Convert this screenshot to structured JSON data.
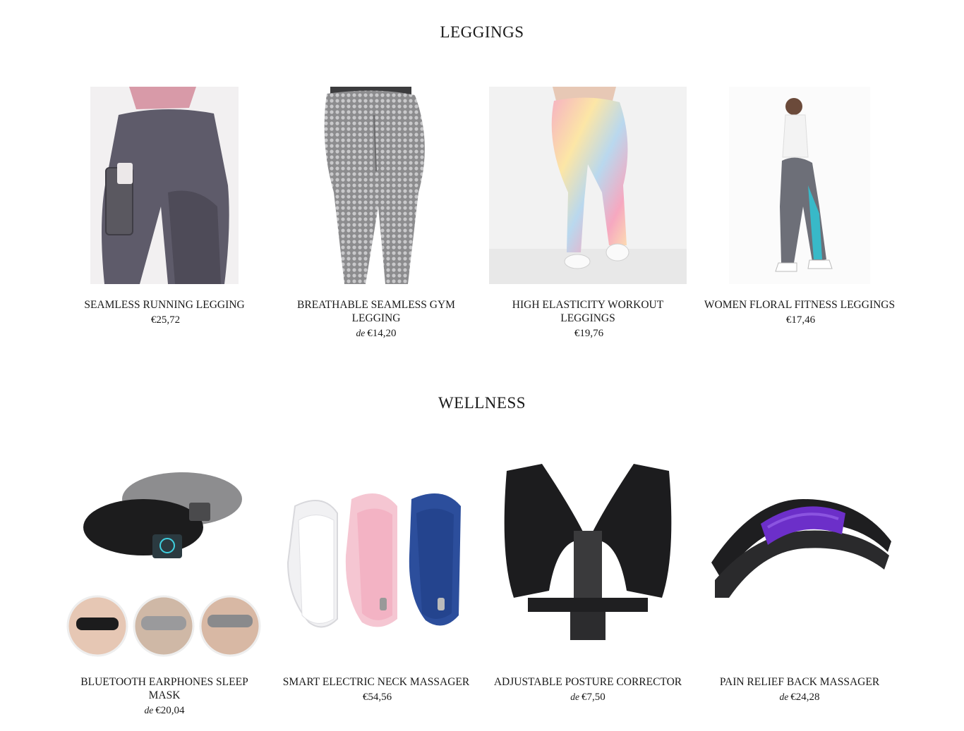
{
  "sections": [
    {
      "title": "LEGGINGS",
      "products": [
        {
          "name": "SEAMLESS RUNNING LEGGING",
          "price": "€25,72",
          "from": ""
        },
        {
          "name": "BREATHABLE SEAMLESS GYM LEGGING",
          "price": "€14,20",
          "from": "de"
        },
        {
          "name": "HIGH ELASTICITY WORKOUT LEGGINGS",
          "price": "€19,76",
          "from": ""
        },
        {
          "name": "WOMEN FLORAL FITNESS LEGGINGS",
          "price": "€17,46",
          "from": ""
        }
      ]
    },
    {
      "title": "WELLNESS",
      "products": [
        {
          "name": "BLUETOOTH EARPHONES SLEEP MASK",
          "price": "€20,04",
          "from": "de"
        },
        {
          "name": "SMART ELECTRIC NECK MASSAGER",
          "price": "€54,56",
          "from": ""
        },
        {
          "name": "ADJUSTABLE POSTURE CORRECTOR",
          "price": "€7,50",
          "from": "de"
        },
        {
          "name": "PAIN RELIEF BACK MASSAGER",
          "price": "€24,28",
          "from": "de"
        }
      ]
    }
  ]
}
